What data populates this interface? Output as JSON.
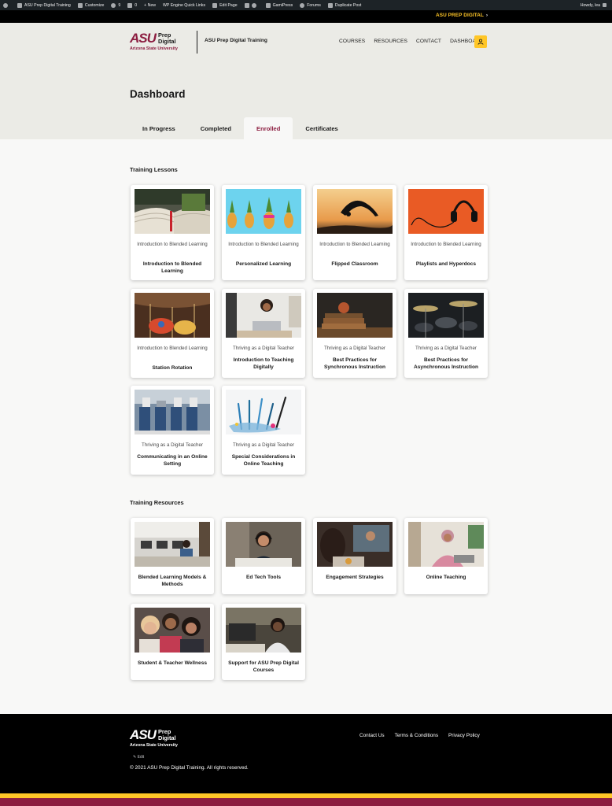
{
  "admin_bar": {
    "items": [
      "ASU Prep Digital Training",
      "Customize",
      "9",
      "0",
      "+ New",
      "WP Engine Quick Links",
      "Edit Page",
      "GamiPress",
      "Forums",
      "Duplicate Post"
    ],
    "greeting": "Howdy, lea"
  },
  "top_bar": {
    "link": "ASU PREP DIGITAL",
    "arrow": "›"
  },
  "header": {
    "logo": {
      "asu": "ASU",
      "prep_line1": "Prep",
      "prep_line2": "Digital",
      "university": "Arizona State University"
    },
    "site_title": "ASU Prep Digital Training",
    "nav": [
      "COURSES",
      "RESOURCES",
      "CONTACT",
      "DASHBOARD"
    ]
  },
  "page": {
    "title": "Dashboard",
    "tabs": [
      "In Progress",
      "Completed",
      "Enrolled",
      "Certificates"
    ],
    "active_tab": "Enrolled"
  },
  "lessons": {
    "heading": "Training Lessons",
    "items": [
      {
        "course": "Introduction to Blended Learning",
        "title": "Introduction to Blended Learning",
        "image": "open-book-photo"
      },
      {
        "course": "Introduction to Blended Learning",
        "title": "Personalized Learning",
        "image": "pineapples-photo"
      },
      {
        "course": "Introduction to Blended Learning",
        "title": "Flipped Classroom",
        "image": "backflip-sunset-photo"
      },
      {
        "course": "Introduction to Blended Learning",
        "title": "Playlists and Hyperdocs",
        "image": "headphones-photo"
      },
      {
        "course": "Introduction to Blended Learning",
        "title": "Station Rotation",
        "image": "carousel-photo"
      },
      {
        "course": "Thriving as a Digital Teacher",
        "title": "Introduction to Teaching Digitally",
        "image": "teacher-laptop-photo"
      },
      {
        "course": "Thriving as a Digital Teacher",
        "title": "Best Practices for Synchronous Instruction",
        "image": "books-apple-photo"
      },
      {
        "course": "Thriving as a Digital Teacher",
        "title": "Best Practices for Asynchronous Instruction",
        "image": "drum-kit-photo"
      },
      {
        "course": "Thriving as a Digital Teacher",
        "title": "Communicating in an Online Setting",
        "image": "students-bench-photo"
      },
      {
        "course": "Thriving as a Digital Teacher",
        "title": "Special Considerations in Online Teaching",
        "image": "paint-brushes-photo"
      }
    ]
  },
  "resources": {
    "heading": "Training Resources",
    "items": [
      {
        "title": "Blended Learning Models & Methods",
        "image": "computer-lab-photo"
      },
      {
        "title": "Ed Tech Tools",
        "image": "headset-teacher-photo"
      },
      {
        "title": "Engagement Strategies",
        "image": "video-call-photo"
      },
      {
        "title": "Online Teaching",
        "image": "student-tablet-photo"
      },
      {
        "title": "Student & Teacher Wellness",
        "image": "friends-smiling-photo"
      },
      {
        "title": "Support for ASU Prep Digital Courses",
        "image": "student-computer-photo"
      }
    ]
  },
  "footer": {
    "logo": {
      "asu": "ASU",
      "prep_line1": "Prep",
      "prep_line2": "Digital",
      "university": "Arizona State University"
    },
    "links": [
      "Contact Us",
      "Terms & Conditions",
      "Privacy Policy"
    ],
    "edit": "✎ Edit",
    "copyright": "© 2021 ASU Prep Digital Training. All rights reserved."
  },
  "colors": {
    "maroon": "#8c1d40",
    "gold": "#ffc627",
    "black": "#000000",
    "band": "#ebebe6"
  }
}
